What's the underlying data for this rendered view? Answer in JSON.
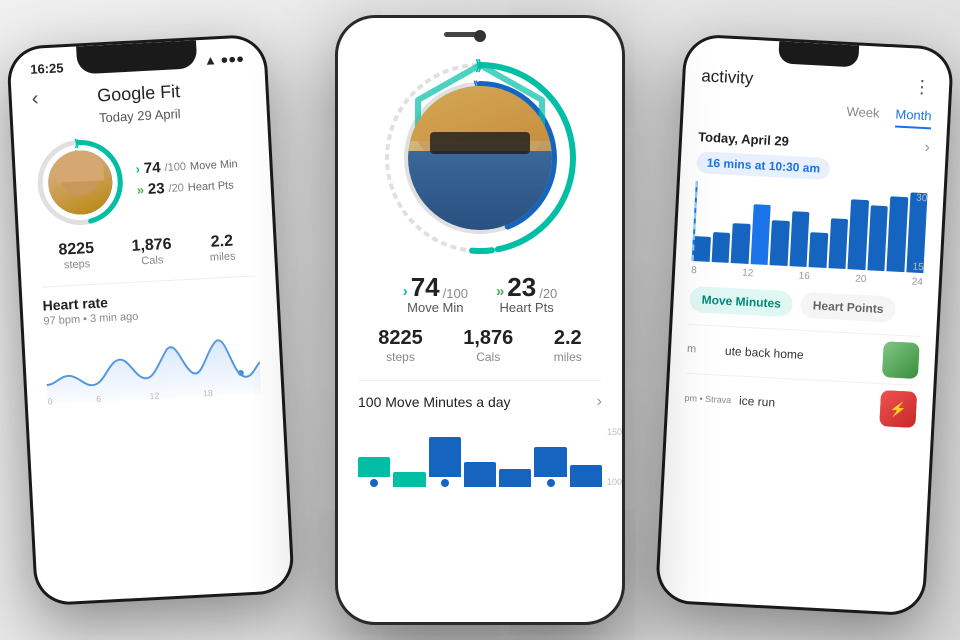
{
  "background": "#e0e0e0",
  "left_phone": {
    "status_bar": {
      "time": "16:25",
      "signal": "↑"
    },
    "title": "Google Fit",
    "date": "Today 29 April",
    "ring": {
      "move_min_val": "74",
      "move_min_goal": "100",
      "move_min_label": "Move Min",
      "heart_pts_val": "23",
      "heart_pts_goal": "20",
      "heart_pts_label": "Heart Pts"
    },
    "stats": {
      "steps": "8225",
      "steps_label": "steps",
      "cals": "1,876",
      "cals_label": "Cals",
      "miles": "2.2",
      "miles_label": "miles"
    },
    "heart_rate": {
      "title": "Heart rate",
      "subtitle": "97 bpm • 3 min ago"
    }
  },
  "center_phone": {
    "ring": {
      "move_min_val": "74",
      "move_min_goal": "100",
      "move_min_label": "Move Min",
      "heart_pts_val": "23",
      "heart_pts_goal": "20",
      "heart_pts_label": "Heart Pts"
    },
    "stats": {
      "steps": "8225",
      "steps_label": "steps",
      "cals": "1,876",
      "cals_label": "Cals",
      "miles": "2.2",
      "miles_label": "miles"
    },
    "section_label": "100 Move Minutes a day",
    "bar_target": "150",
    "bar_current": "100"
  },
  "right_phone": {
    "title": "activity",
    "tabs": {
      "week": "Week",
      "month": "Month"
    },
    "date_label": "Today, April 29",
    "activity_badge": "16 mins at 10:30 am",
    "chart_labels": [
      "8",
      "12",
      "16",
      "20",
      "24"
    ],
    "chart_y": [
      "30",
      "15"
    ],
    "toggle_buttons": {
      "move_minutes": "Move Minutes",
      "heart_points": "Heart Points"
    },
    "activities": [
      {
        "time": "m",
        "text": "ute back home"
      },
      {
        "time": "pm • Strava",
        "text": "ice run"
      }
    ]
  }
}
